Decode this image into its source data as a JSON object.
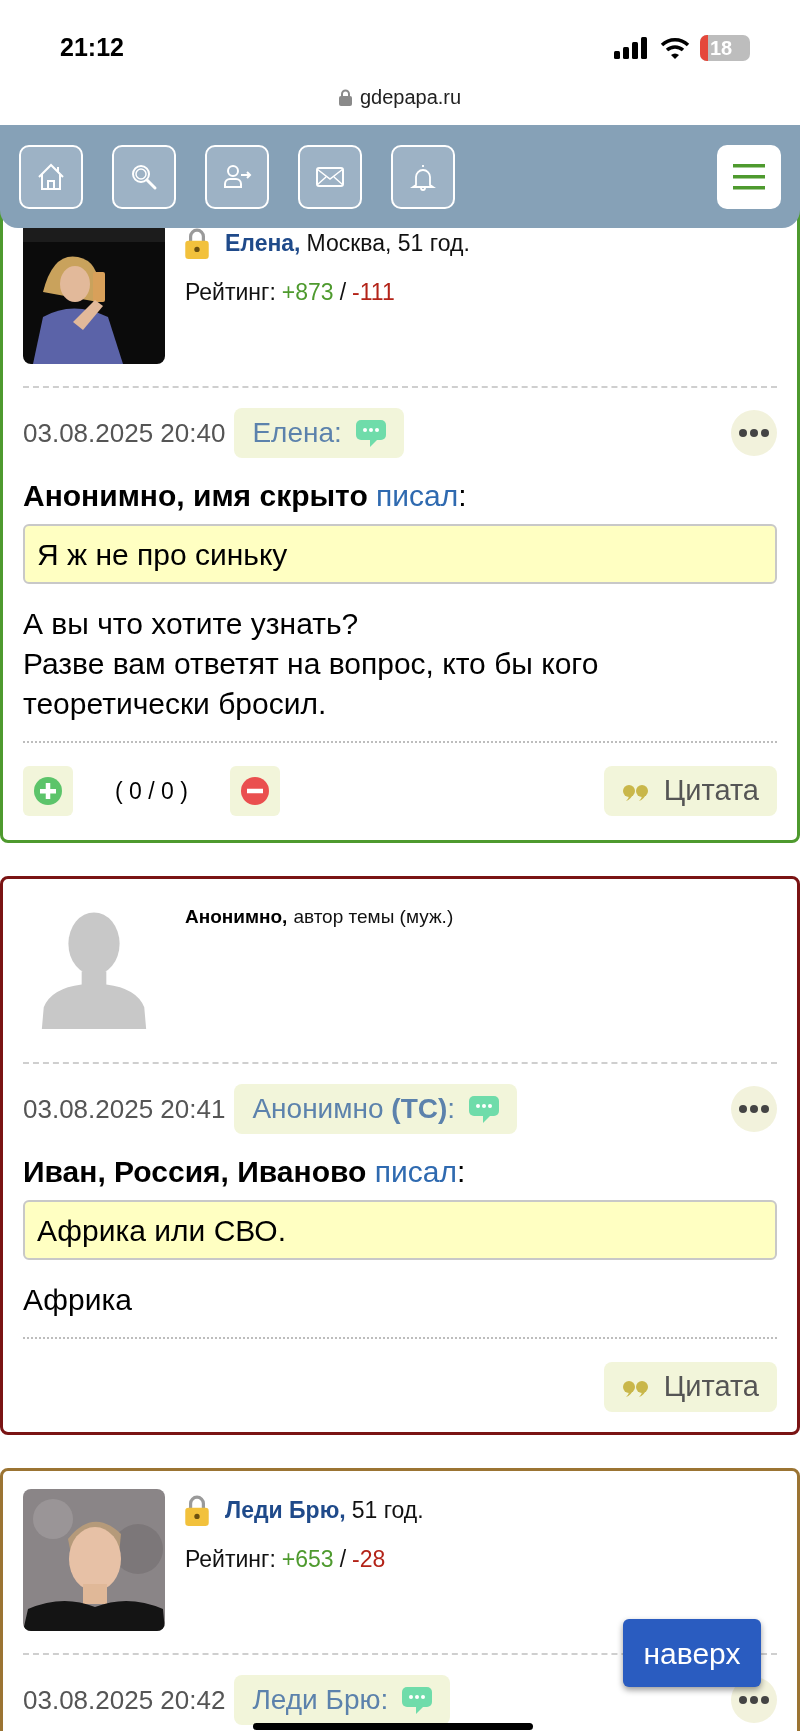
{
  "status_bar": {
    "time": "21:12",
    "battery": "18"
  },
  "address_bar": {
    "url": "gdepapa.ru",
    "secure": true
  },
  "nav": {
    "buttons": [
      {
        "kind": "home"
      },
      {
        "kind": "search"
      },
      {
        "kind": "login"
      },
      {
        "kind": "mail"
      },
      {
        "kind": "bell"
      }
    ],
    "menu": true
  },
  "posts": [
    {
      "color": "#4e9a2e",
      "avatar": {
        "kind": "picture"
      },
      "locked": true,
      "name": "Елена,",
      "name_link": true,
      "details": "Москва, 51 год.",
      "rating": {
        "label": "Рейтинг:",
        "plus": "+873",
        "sep": "/",
        "minus": "-111"
      },
      "date": "03.08.2025 20:40",
      "badge": "Елена:",
      "quote_author": "Анонимно, имя скрыто",
      "quote_verb": "писал",
      "quote_colon": ":",
      "quote": "Я ж не про синьку",
      "body": [
        "А вы что хотите узнать?",
        "Разве вам ответят на вопрос, кто бы кого теоретически бросил."
      ],
      "votes": "( 0 / 0 )",
      "quote_button": "Цитата"
    },
    {
      "color": "#7a1414",
      "avatar": {
        "kind": "silhouette"
      },
      "locked": false,
      "name": "Анонимно,",
      "name_link": false,
      "details": "автор темы (муж.)",
      "date": "03.08.2025 20:41",
      "badge": "Анонимно **(ТС)**:",
      "quote_author": "Иван, Россия, Иваново",
      "quote_verb": "писал",
      "quote_colon": ":",
      "quote": "Африка или СВО.",
      "body": [
        "Африка"
      ],
      "quote_button": "Цитата"
    },
    {
      "color": "#9b7433",
      "avatar": {
        "kind": "picture"
      },
      "locked": true,
      "name": "Леди Брю,",
      "name_link": true,
      "details": "51 год.",
      "rating": {
        "label": "Рейтинг:",
        "plus": "+653",
        "sep": "/",
        "minus": "-28"
      },
      "date": "03.08.2025 20:42",
      "badge": "Леди Брю:"
    }
  ],
  "scroll_top_button": "наверх"
}
